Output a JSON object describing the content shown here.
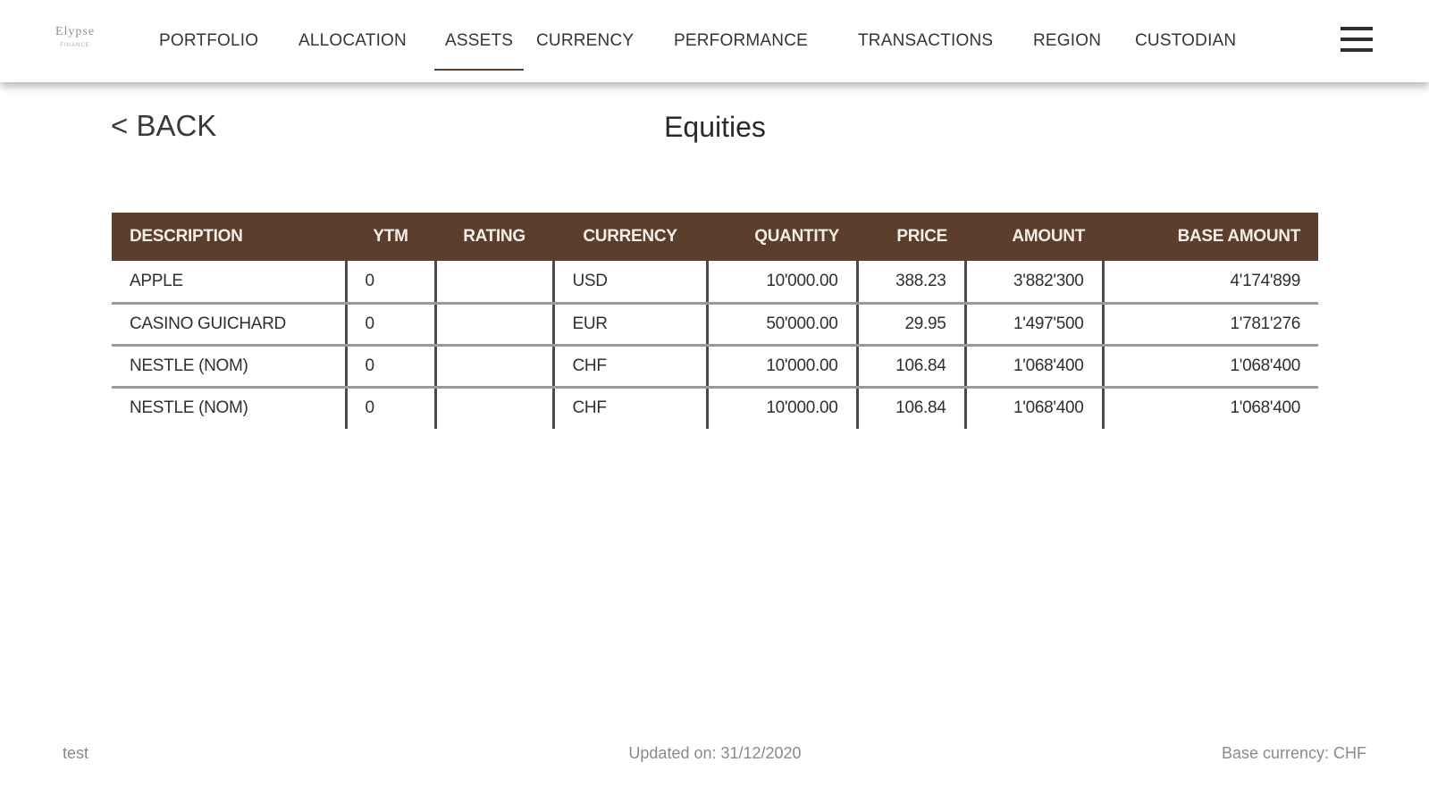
{
  "header": {
    "logo": {
      "word": "Elypse",
      "sub": "FINANCE"
    },
    "nav": [
      {
        "label": "PORTFOLIO",
        "active": false
      },
      {
        "label": "ALLOCATION",
        "active": false
      },
      {
        "label": "ASSETS",
        "active": true
      },
      {
        "label": "CURRENCY",
        "active": false
      },
      {
        "label": "PERFORMANCE",
        "active": false
      },
      {
        "label": "TRANSACTIONS",
        "active": false
      },
      {
        "label": "REGION",
        "active": false
      },
      {
        "label": "CUSTODIAN",
        "active": false
      }
    ],
    "menu_icon": "hamburger-menu-icon"
  },
  "page": {
    "back_label": "< BACK",
    "title": "Equities"
  },
  "table": {
    "columns": [
      "DESCRIPTION",
      "YTM",
      "RATING",
      "CURRENCY",
      "QUANTITY",
      "PRICE",
      "AMOUNT",
      "BASE AMOUNT"
    ],
    "rows": [
      [
        "APPLE",
        "0",
        "",
        "USD",
        "10'000.00",
        "388.23",
        "3'882'300",
        "4'174'899"
      ],
      [
        "CASINO GUICHARD",
        "0",
        "",
        "EUR",
        "50'000.00",
        "29.95",
        "1'497'500",
        "1'781'276"
      ],
      [
        "NESTLE (NOM)",
        "0",
        "",
        "CHF",
        "10'000.00",
        "106.84",
        "1'068'400",
        "1'068'400"
      ],
      [
        "NESTLE (NOM)",
        "0",
        "",
        "CHF",
        "10'000.00",
        "106.84",
        "1'068'400",
        "1'068'400"
      ]
    ]
  },
  "footer": {
    "left": "test",
    "center": "Updated on: 31/12/2020",
    "right": "Base currency: CHF"
  },
  "colors": {
    "header_bg": "#5b3f2c",
    "accent": "#5b4332"
  }
}
